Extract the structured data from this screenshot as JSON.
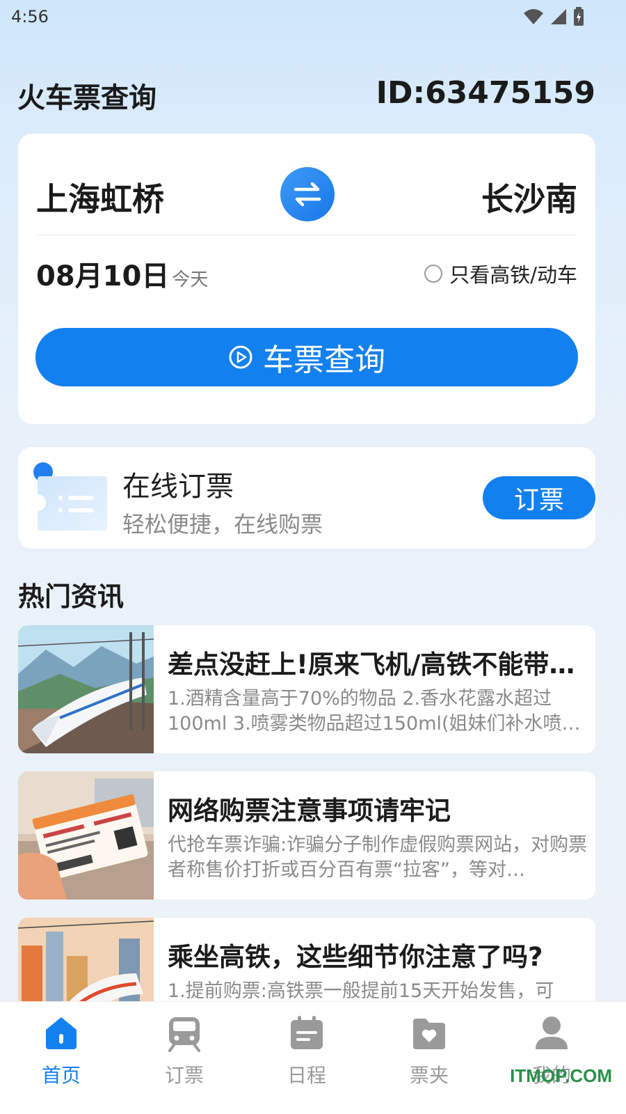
{
  "status_bar": {
    "time": "4:56"
  },
  "header": {
    "title": "火车票查询",
    "user_id": "ID:63475159"
  },
  "search": {
    "from_station": "上海虹桥",
    "to_station": "长沙南",
    "date": "08月10日",
    "date_sub": "今天",
    "filter_label": "只看高铁/动车",
    "filter_checked": false,
    "button_label": "车票查询"
  },
  "booking": {
    "title": "在线订票",
    "subtitle": "轻松便捷，在线购票",
    "button_label": "订票"
  },
  "news": {
    "heading": "热门资讯",
    "items": [
      {
        "title": "差点没赶上!原来飞机/高铁不能带…",
        "summary": "1.酒精含量高于70%的物品 2.香水花露水超过100ml 3.喷雾类物品超过150ml(姐妹们补水喷…"
      },
      {
        "title": "网络购票注意事项请牢记",
        "summary": "代抢车票诈骗:诈骗分子制作虚假购票网站，对购票者称售价打折或百分百有票“拉客”，等对…"
      },
      {
        "title": "乘坐高铁，这些细节你注意了吗?",
        "summary": "1.提前购票:高铁票一般提前15天开始发售，可"
      }
    ]
  },
  "nav": {
    "items": [
      {
        "label": "首页",
        "icon": "home-icon",
        "active": true
      },
      {
        "label": "订票",
        "icon": "train-icon",
        "active": false
      },
      {
        "label": "日程",
        "icon": "calendar-icon",
        "active": false
      },
      {
        "label": "票夹",
        "icon": "wallet-icon",
        "active": false
      },
      {
        "label": "我的",
        "icon": "profile-icon",
        "active": false
      }
    ]
  },
  "watermark": "ITMOP.COM",
  "colors": {
    "accent": "#1380ef",
    "inactive": "#9a9a9a"
  }
}
